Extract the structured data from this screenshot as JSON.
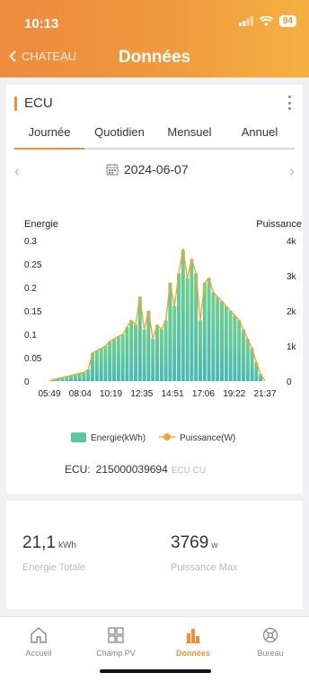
{
  "status": {
    "time": "10:13",
    "battery": "94"
  },
  "header": {
    "back_label": "CHATEAU",
    "title": "Données"
  },
  "card": {
    "title": "ECU",
    "tabs": [
      "Journée",
      "Quotidien",
      "Mensuel",
      "Annuel"
    ],
    "active_tab": 0,
    "date": "2024-06-07"
  },
  "ecu": {
    "label": "ECU:",
    "id": "215000039694",
    "extra": "ECU CU"
  },
  "stats": {
    "energy": {
      "value": "21,1",
      "unit": "kWh",
      "label": "Energie Totale"
    },
    "power": {
      "value": "3769",
      "unit": "w",
      "label": "Puissance Max"
    }
  },
  "nav": [
    {
      "label": "Accueil",
      "icon": "home-icon"
    },
    {
      "label": "Champ PV",
      "icon": "grid-icon"
    },
    {
      "label": "Données",
      "icon": "bar-chart-icon",
      "active": true
    },
    {
      "label": "Bureau",
      "icon": "office-icon"
    }
  ],
  "colors": {
    "accent": "#ef8f3d",
    "energy": "#5ec79a",
    "power": "#f0a53a"
  },
  "chart_data": {
    "type": "bar",
    "ylabel_left": "Energie",
    "ylabel_right": "Puissance",
    "y_left_ticks": [
      "0.3",
      "0.25",
      "0.2",
      "0.15",
      "0.1",
      "0.05",
      "0"
    ],
    "y_right_ticks": [
      "4k",
      "3k",
      "2k",
      "1k",
      "0"
    ],
    "ylim_left": [
      0,
      0.3
    ],
    "ylim_right": [
      0,
      4000
    ],
    "x_ticks": [
      "05:49",
      "08:04",
      "10:19",
      "12:35",
      "14:51",
      "17:06",
      "19:22",
      "21:37"
    ],
    "series": [
      {
        "name": "Energie(kWh)",
        "values": [
          0,
          0.004,
          0.006,
          0.008,
          0.01,
          0.012,
          0.014,
          0.016,
          0.018,
          0.025,
          0.06,
          0.065,
          0.07,
          0.075,
          0.085,
          0.09,
          0.095,
          0.1,
          0.115,
          0.13,
          0.12,
          0.18,
          0.11,
          0.15,
          0.09,
          0.12,
          0.11,
          0.13,
          0.21,
          0.16,
          0.23,
          0.28,
          0.22,
          0.26,
          0.23,
          0.13,
          0.21,
          0.22,
          0.19,
          0.18,
          0.17,
          0.16,
          0.15,
          0.14,
          0.13,
          0.11,
          0.09,
          0.07,
          0.04,
          0.015,
          0
        ]
      },
      {
        "name": "Puissance(W)",
        "values": [
          0,
          50,
          80,
          100,
          130,
          160,
          190,
          220,
          250,
          330,
          800,
          870,
          930,
          1000,
          1130,
          1200,
          1270,
          1330,
          1530,
          1730,
          1600,
          2400,
          1470,
          2000,
          1200,
          1600,
          1470,
          1730,
          2800,
          2130,
          3070,
          3769,
          2930,
          3470,
          3070,
          1730,
          2800,
          2930,
          2530,
          2400,
          2270,
          2130,
          2000,
          1870,
          1730,
          1470,
          1200,
          930,
          530,
          200,
          0
        ]
      }
    ],
    "legend_position": "bottom"
  }
}
